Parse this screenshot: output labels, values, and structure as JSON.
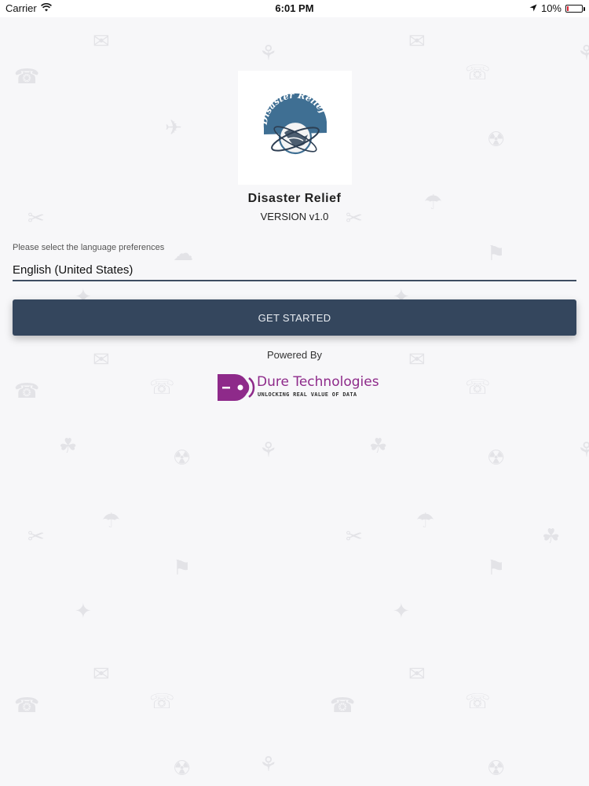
{
  "status_bar": {
    "carrier": "Carrier",
    "time": "6:01 PM",
    "battery": "10%",
    "battery_level": 0.1,
    "icons": [
      "wifi-icon",
      "location-arrow-icon",
      "battery-icon"
    ]
  },
  "app": {
    "logo_text": "Disaster Relief",
    "name": "Disaster Relief",
    "version": "VERSION v1.0"
  },
  "language": {
    "label": "Please select the language preferences",
    "selected": "English (United States)"
  },
  "actions": {
    "get_started": "GET STARTED"
  },
  "footer": {
    "powered_by": "Powered By",
    "company_name": "Dure Technologies",
    "company_tagline": "UNLOCKING REAL VALUE OF DATA"
  },
  "colors": {
    "background": "#f7f7f9",
    "button": "#34465d",
    "underline": "#3e4d61",
    "brand_purple": "#8e2a8a",
    "logo_blue": "#3f6f93"
  }
}
